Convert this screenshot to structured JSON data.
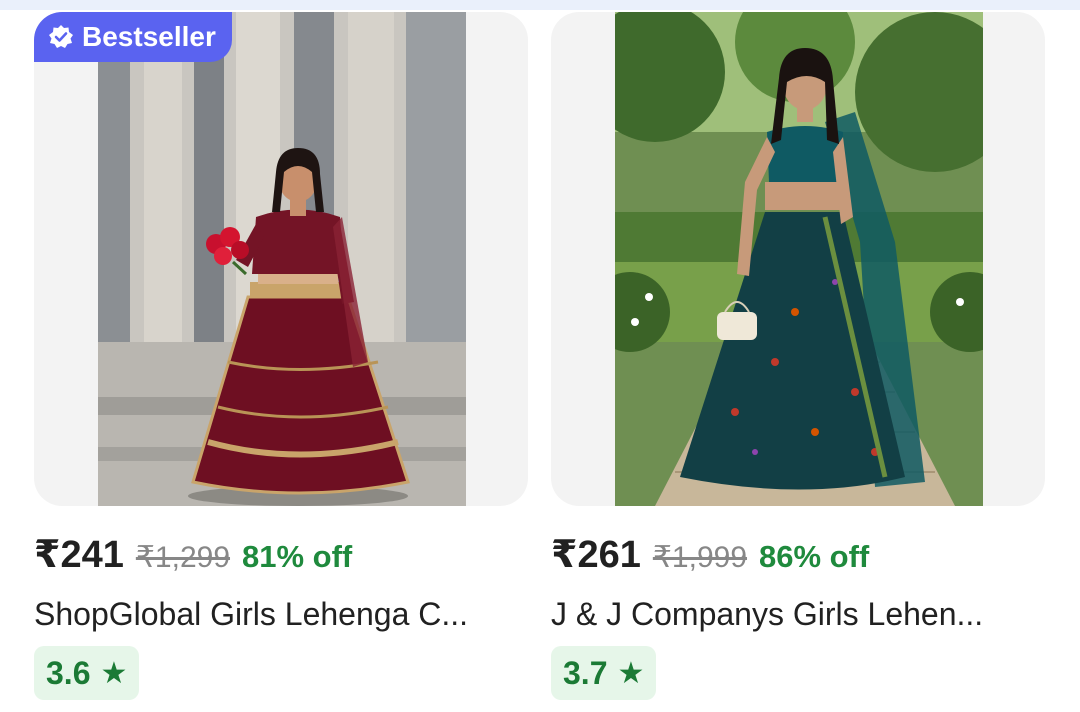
{
  "products": [
    {
      "badge": "Bestseller",
      "badge_icon": "verified-check-icon",
      "price": "₹241",
      "mrp": "₹1,299",
      "discount": "81% off",
      "title": "ShopGlobal Girls Lehenga C...",
      "rating": "3.6",
      "rating_icon": "★",
      "image": "girl-in-maroon-lehenga-with-red-roses"
    },
    {
      "price": "₹261",
      "mrp": "₹1,999",
      "discount": "86% off",
      "title": "J & J Companys Girls Lehen...",
      "rating": "3.7",
      "rating_icon": "★",
      "image": "girl-in-teal-floral-lehenga-with-dupatta"
    }
  ],
  "colors": {
    "badge": "#5a63f0",
    "discount": "#1f8a3d",
    "rating_bg": "#e6f6e9",
    "rating_text": "#1b7a35"
  }
}
